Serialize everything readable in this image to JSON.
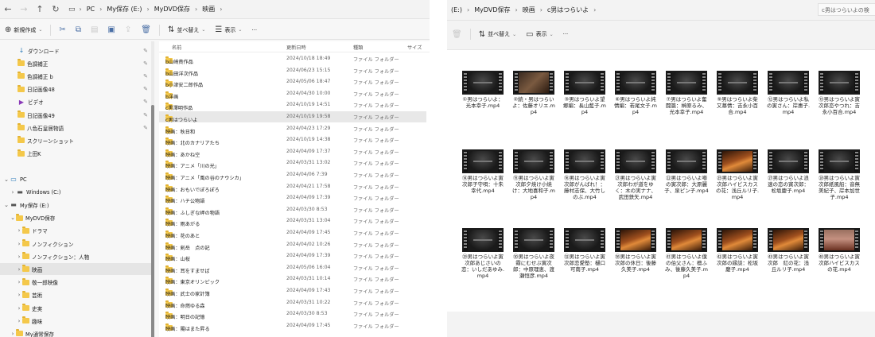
{
  "left": {
    "nav": {
      "back": "←",
      "forward": "→",
      "up": "↑",
      "refresh": "↻"
    },
    "breadcrumb": [
      "PC",
      "My保存 (E:)",
      "MyDVD保存",
      "映画"
    ],
    "toolbar": {
      "new_label": "新規作成",
      "sort_label": "並べ替え",
      "view_label": "表示",
      "more": "···"
    },
    "tree": [
      {
        "label": "ダウンロード",
        "icon": "download-icon",
        "pin": true
      },
      {
        "label": "色調補正",
        "icon": "folder-icon",
        "pin": true
      },
      {
        "label": "色調補正 b",
        "icon": "folder-icon",
        "pin": true
      },
      {
        "label": "日記画像48",
        "icon": "folder-icon",
        "pin": true
      },
      {
        "label": "ビデオ",
        "icon": "video-icon",
        "pin": true
      },
      {
        "label": "日記画像49",
        "icon": "folder-icon",
        "pin": true
      },
      {
        "label": "八色石皇居物語",
        "icon": "folder-icon",
        "pin": true
      },
      {
        "label": "スクリーンショット",
        "icon": "folder-icon",
        "pin": false
      },
      {
        "label": "上田K",
        "icon": "folder-icon",
        "pin": false
      },
      {
        "label": "",
        "icon": "",
        "pin": false
      },
      {
        "label": "PC",
        "icon": "pc-icon",
        "pin": false,
        "exp": "⌄"
      },
      {
        "label": "Windows (C:)",
        "icon": "drive-icon",
        "pin": false,
        "exp": "›"
      },
      {
        "label": "My保存 (E:)",
        "icon": "drive-icon",
        "pin": false,
        "exp": "⌄"
      },
      {
        "label": "MyDVD保存",
        "icon": "folder-icon",
        "pin": false,
        "exp": "⌄"
      },
      {
        "label": "ドラマ",
        "icon": "folder-icon",
        "pin": false,
        "exp": "›"
      },
      {
        "label": "ノンフィクション",
        "icon": "folder-icon",
        "pin": false,
        "exp": "›"
      },
      {
        "label": "ノンフィクション：人物",
        "icon": "folder-icon",
        "pin": false,
        "exp": "›"
      },
      {
        "label": "映画",
        "icon": "folder-icon",
        "pin": false,
        "exp": "›",
        "selected": true
      },
      {
        "label": "敬一郎映像",
        "icon": "folder-icon",
        "pin": false,
        "exp": "›"
      },
      {
        "label": "芸術",
        "icon": "folder-icon",
        "pin": false,
        "exp": "›"
      },
      {
        "label": "史実",
        "icon": "folder-icon",
        "pin": false,
        "exp": "›"
      },
      {
        "label": "趣味",
        "icon": "folder-icon",
        "pin": false,
        "exp": "›"
      },
      {
        "label": "My通常保存",
        "icon": "folder-icon",
        "pin": false,
        "exp": "›"
      }
    ],
    "columns": {
      "name": "名前",
      "date": "更新日時",
      "kind": "種類",
      "size": "サイズ"
    },
    "files": [
      {
        "name": "b山崎貴作品",
        "date": "2024/10/18 18:49",
        "kind": "ファイル フォルダー"
      },
      {
        "name": "b山田洋次作品",
        "date": "2024/06/23 15:15",
        "kind": "ファイル フォルダー"
      },
      {
        "name": "b小津安二郎作品",
        "date": "2024/05/06 18:47",
        "kind": "ファイル フォルダー"
      },
      {
        "name": "b洋画",
        "date": "2024/04/30 10:00",
        "kind": "ファイル フォルダー"
      },
      {
        "name": "c黒澤明作品",
        "date": "2024/10/19 14:51",
        "kind": "ファイル フォルダー"
      },
      {
        "name": "c男はつらいよ",
        "date": "2024/10/19 19:58",
        "kind": "ファイル フォルダー",
        "selected": true
      },
      {
        "name": "映画：秋日和",
        "date": "2024/04/23 17:29",
        "kind": "ファイル フォルダー"
      },
      {
        "name": "映画：北のカナリアたち",
        "date": "2024/10/19 14:38",
        "kind": "ファイル フォルダー"
      },
      {
        "name": "映画：あかね空",
        "date": "2024/04/09 17:37",
        "kind": "ファイル フォルダー"
      },
      {
        "name": "映画：アニメ「川の光」",
        "date": "2024/03/31 13:02",
        "kind": "ファイル フォルダー"
      },
      {
        "name": "映画：アニメ「風の谷のナウシカ」",
        "date": "2024/04/06 7:39",
        "kind": "ファイル フォルダー"
      },
      {
        "name": "映画：おもいでぽろぽろ",
        "date": "2024/04/21 17:58",
        "kind": "ファイル フォルダー"
      },
      {
        "name": "映画：ハチ公物語",
        "date": "2024/04/09 17:39",
        "kind": "ファイル フォルダー"
      },
      {
        "name": "映画：ふしぎな岬の物語",
        "date": "2024/03/30 8:53",
        "kind": "ファイル フォルダー"
      },
      {
        "name": "映画：雨あがる",
        "date": "2024/03/31 13:04",
        "kind": "ファイル フォルダー"
      },
      {
        "name": "映画：花のあと",
        "date": "2024/04/09 17:45",
        "kind": "ファイル フォルダー"
      },
      {
        "name": "映画：剣岳　点の記",
        "date": "2024/04/02 10:26",
        "kind": "ファイル フォルダー"
      },
      {
        "name": "映画：山桜",
        "date": "2024/04/09 17:39",
        "kind": "ファイル フォルダー"
      },
      {
        "name": "映画：耳をすませば",
        "date": "2024/05/06 16:04",
        "kind": "ファイル フォルダー"
      },
      {
        "name": "映画：東京オリンピック",
        "date": "2024/03/31 10:14",
        "kind": "ファイル フォルダー"
      },
      {
        "name": "映画：武士の家計簿",
        "date": "2024/04/09 17:43",
        "kind": "ファイル フォルダー"
      },
      {
        "name": "映画：命燃ゆる森",
        "date": "2024/03/31 10:22",
        "kind": "ファイル フォルダー"
      },
      {
        "name": "映画：明日の記憶",
        "date": "2024/03/30 8:53",
        "kind": "ファイル フォルダー"
      },
      {
        "name": "映画：陽はまた昇る",
        "date": "2024/04/09 17:45",
        "kind": "ファイル フォルダー"
      }
    ]
  },
  "right": {
    "breadcrumb": [
      "(E:)",
      "MyDVD保存",
      "映画",
      "c男はつらいよ"
    ],
    "search_text": "c男はつらいよの検",
    "toolbar": {
      "sort_label": "並べ替え",
      "view_label": "表示",
      "more": "···"
    },
    "videos": [
      {
        "name": "①男はつらいよ：光本幸子.mp4",
        "tone": "dark"
      },
      {
        "name": "②続・男はつらいよ：佐藤オリエ.mp4",
        "tone": "brown"
      },
      {
        "name": "③男はつらいよ望郷編：長山藍子.mp4",
        "tone": "dark"
      },
      {
        "name": "⑥男はつらいよ純情編：若尾文子.mp4",
        "tone": "dark"
      },
      {
        "name": "⑦男はつらいよ奮闘篇：榊原るみ、光本幸子.mp4",
        "tone": "dark"
      },
      {
        "name": "⑨男はつらいよ柴又慕情：吉永小百合.mp4",
        "tone": "dark"
      },
      {
        "name": "⑫男はつらいよ私の寅さん：岸惠子.mp4",
        "tone": "dark"
      },
      {
        "name": "⑬男はつらいよ寅次郎恋やつれ：吉永小百合.mp4",
        "tone": "dark"
      },
      {
        "name": "⑭男はつらいよ寅次郎子守唄：十朱幸代.mp4",
        "tone": "dark"
      },
      {
        "name": "⑮男はつらいよ寅次郎夕焼け小焼け：大地喜和子.mp4",
        "tone": "dark"
      },
      {
        "name": "⑯男はつらいよ寅次郎がんばれ！：藤村志保、大竹しのぶ.mp4",
        "tone": "dark"
      },
      {
        "name": "㉑男はつらいよ寅次郎わが道をゆく：木の実ナナ、武田鉄矢.mp4",
        "tone": "dark"
      },
      {
        "name": "㉒男はつらいよ噂の寅次郎：大原麗子、泉ピン子.mp4",
        "tone": "dark"
      },
      {
        "name": "㉕男はつらいよ寅次郎ハイビスカスの花：浅丘ルリ子.mp4",
        "tone": "orange"
      },
      {
        "name": "㉗男はつらいよ浪速の恋の寅次郎：松坂慶子.mp4",
        "tone": "dark"
      },
      {
        "name": "㉘男はつらいよ寅次郎紙風船：音無美紀子、岸本加世子.mp4",
        "tone": "dark"
      },
      {
        "name": "㉙男はつらいよ寅次郎あじさいの恋：いしだあゆみ.mp4",
        "tone": "dark"
      },
      {
        "name": "㉚男はつらいよ夜霧にむせぶ寅次郎：中原理恵、渡瀬恒彦.mp4",
        "tone": "dark"
      },
      {
        "name": "㉜男はつらいよ寅次郎恋愛塾：樋口可南子.mp4",
        "tone": "dark"
      },
      {
        "name": "㊱男はつらいよ寅次郎の休日：後藤久美子.mp4",
        "tone": "orange"
      },
      {
        "name": "㊶男はつらいよ僕の伯父さん：檀ふみ、後藤久美子.mp4",
        "tone": "orange"
      },
      {
        "name": "㊷男はつらいよ寅次郎の縁談：松坂慶子.mp4",
        "tone": "orange"
      },
      {
        "name": "㊸男はつらいよ寅次郎　紅の花：浅丘ルリ子.mp4",
        "tone": "orange"
      },
      {
        "name": "㊽男はつらいよ寅次郎ハイビスカスの花.mp4",
        "tone": "red"
      }
    ]
  }
}
